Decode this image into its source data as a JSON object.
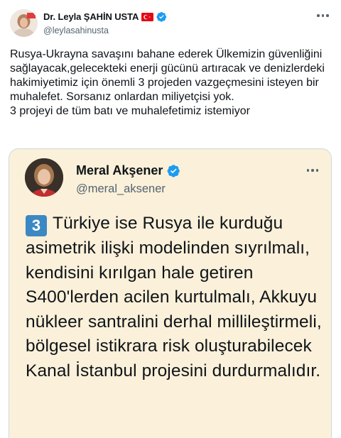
{
  "tweet": {
    "author_name": "Dr. Leyla ŞAHİN USTA",
    "author_handle": "@leylasahinusta",
    "flag_icon": "turkey-flag-icon",
    "verified_icon": "verified-badge-icon",
    "text": "Rusya-Ukrayna savaşını bahane ederek Ülkemizin güvenliğini sağlayacak,gelecekteki enerji gücünü artıracak ve denizlerdeki hakimiyetimiz için önemli 3 projeden vazgeçmesini isteyen bir muhalefet. Sorsanız onlardan miliyetçisi yok.\n3 projeyi de tüm batı ve muhalefetimiz istemiyor"
  },
  "quoted": {
    "author_name": "Meral Akşener",
    "author_handle": "@meral_aksener",
    "number_badge": "3",
    "text": "Türkiye ise Rusya ile kurduğu asimetrik ilişki modelinden sıyrılmalı, kendisini kırılgan hale getiren S400'lerden acilen kurtulmalı, Akkuyu nükleer santralini derhal millileştirmeli, bölgesel istikrara risk oluşturabilecek Kanal İstanbul projesini durdurmalıdır."
  },
  "colors": {
    "verified": "#1d9bf0",
    "card_background": "#fbf0d9",
    "badge": "#3b88c3",
    "secondary_text": "#536471"
  }
}
